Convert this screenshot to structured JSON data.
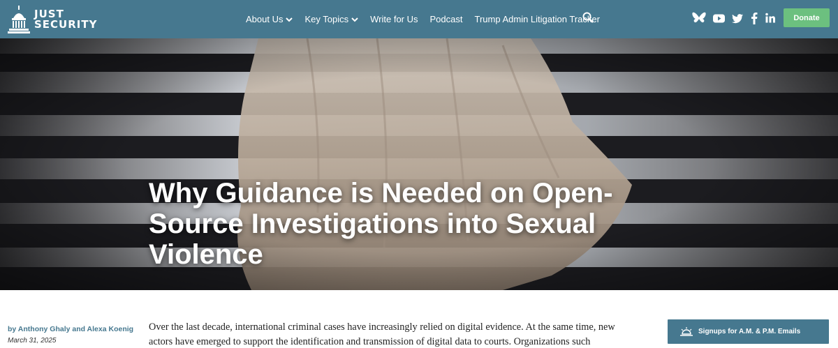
{
  "header": {
    "logo_line1": "JUST",
    "logo_line2": "SECURITY",
    "nav": [
      {
        "label": "About Us",
        "has_dropdown": true
      },
      {
        "label": "Key Topics",
        "has_dropdown": true
      },
      {
        "label": "Write for Us",
        "has_dropdown": false
      },
      {
        "label": "Podcast",
        "has_dropdown": false
      },
      {
        "label": "Trump Admin Litigation Tracker",
        "has_dropdown": false
      }
    ],
    "social_icons": [
      "bluesky-icon",
      "youtube-icon",
      "twitter-icon",
      "facebook-icon",
      "linkedin-icon"
    ],
    "donate_label": "Donate"
  },
  "hero": {
    "title": "Why Guidance is Needed on Open-Source Investigations into Sexual Violence"
  },
  "article": {
    "byline": "by Anthony Ghaly and Alexa Koenig",
    "date": "March 31, 2025",
    "paragraph": "Over the last decade, international criminal cases have increasingly relied on digital evidence. At the same time, new actors have emerged to support the identification and transmission of digital data to courts. Organizations such"
  },
  "sidebar": {
    "signup_label": "Signups for A.M. & P.M. Emails"
  },
  "colors": {
    "header_bg": "#46788f",
    "donate_bg": "#6cc07f",
    "link": "#46788f"
  }
}
